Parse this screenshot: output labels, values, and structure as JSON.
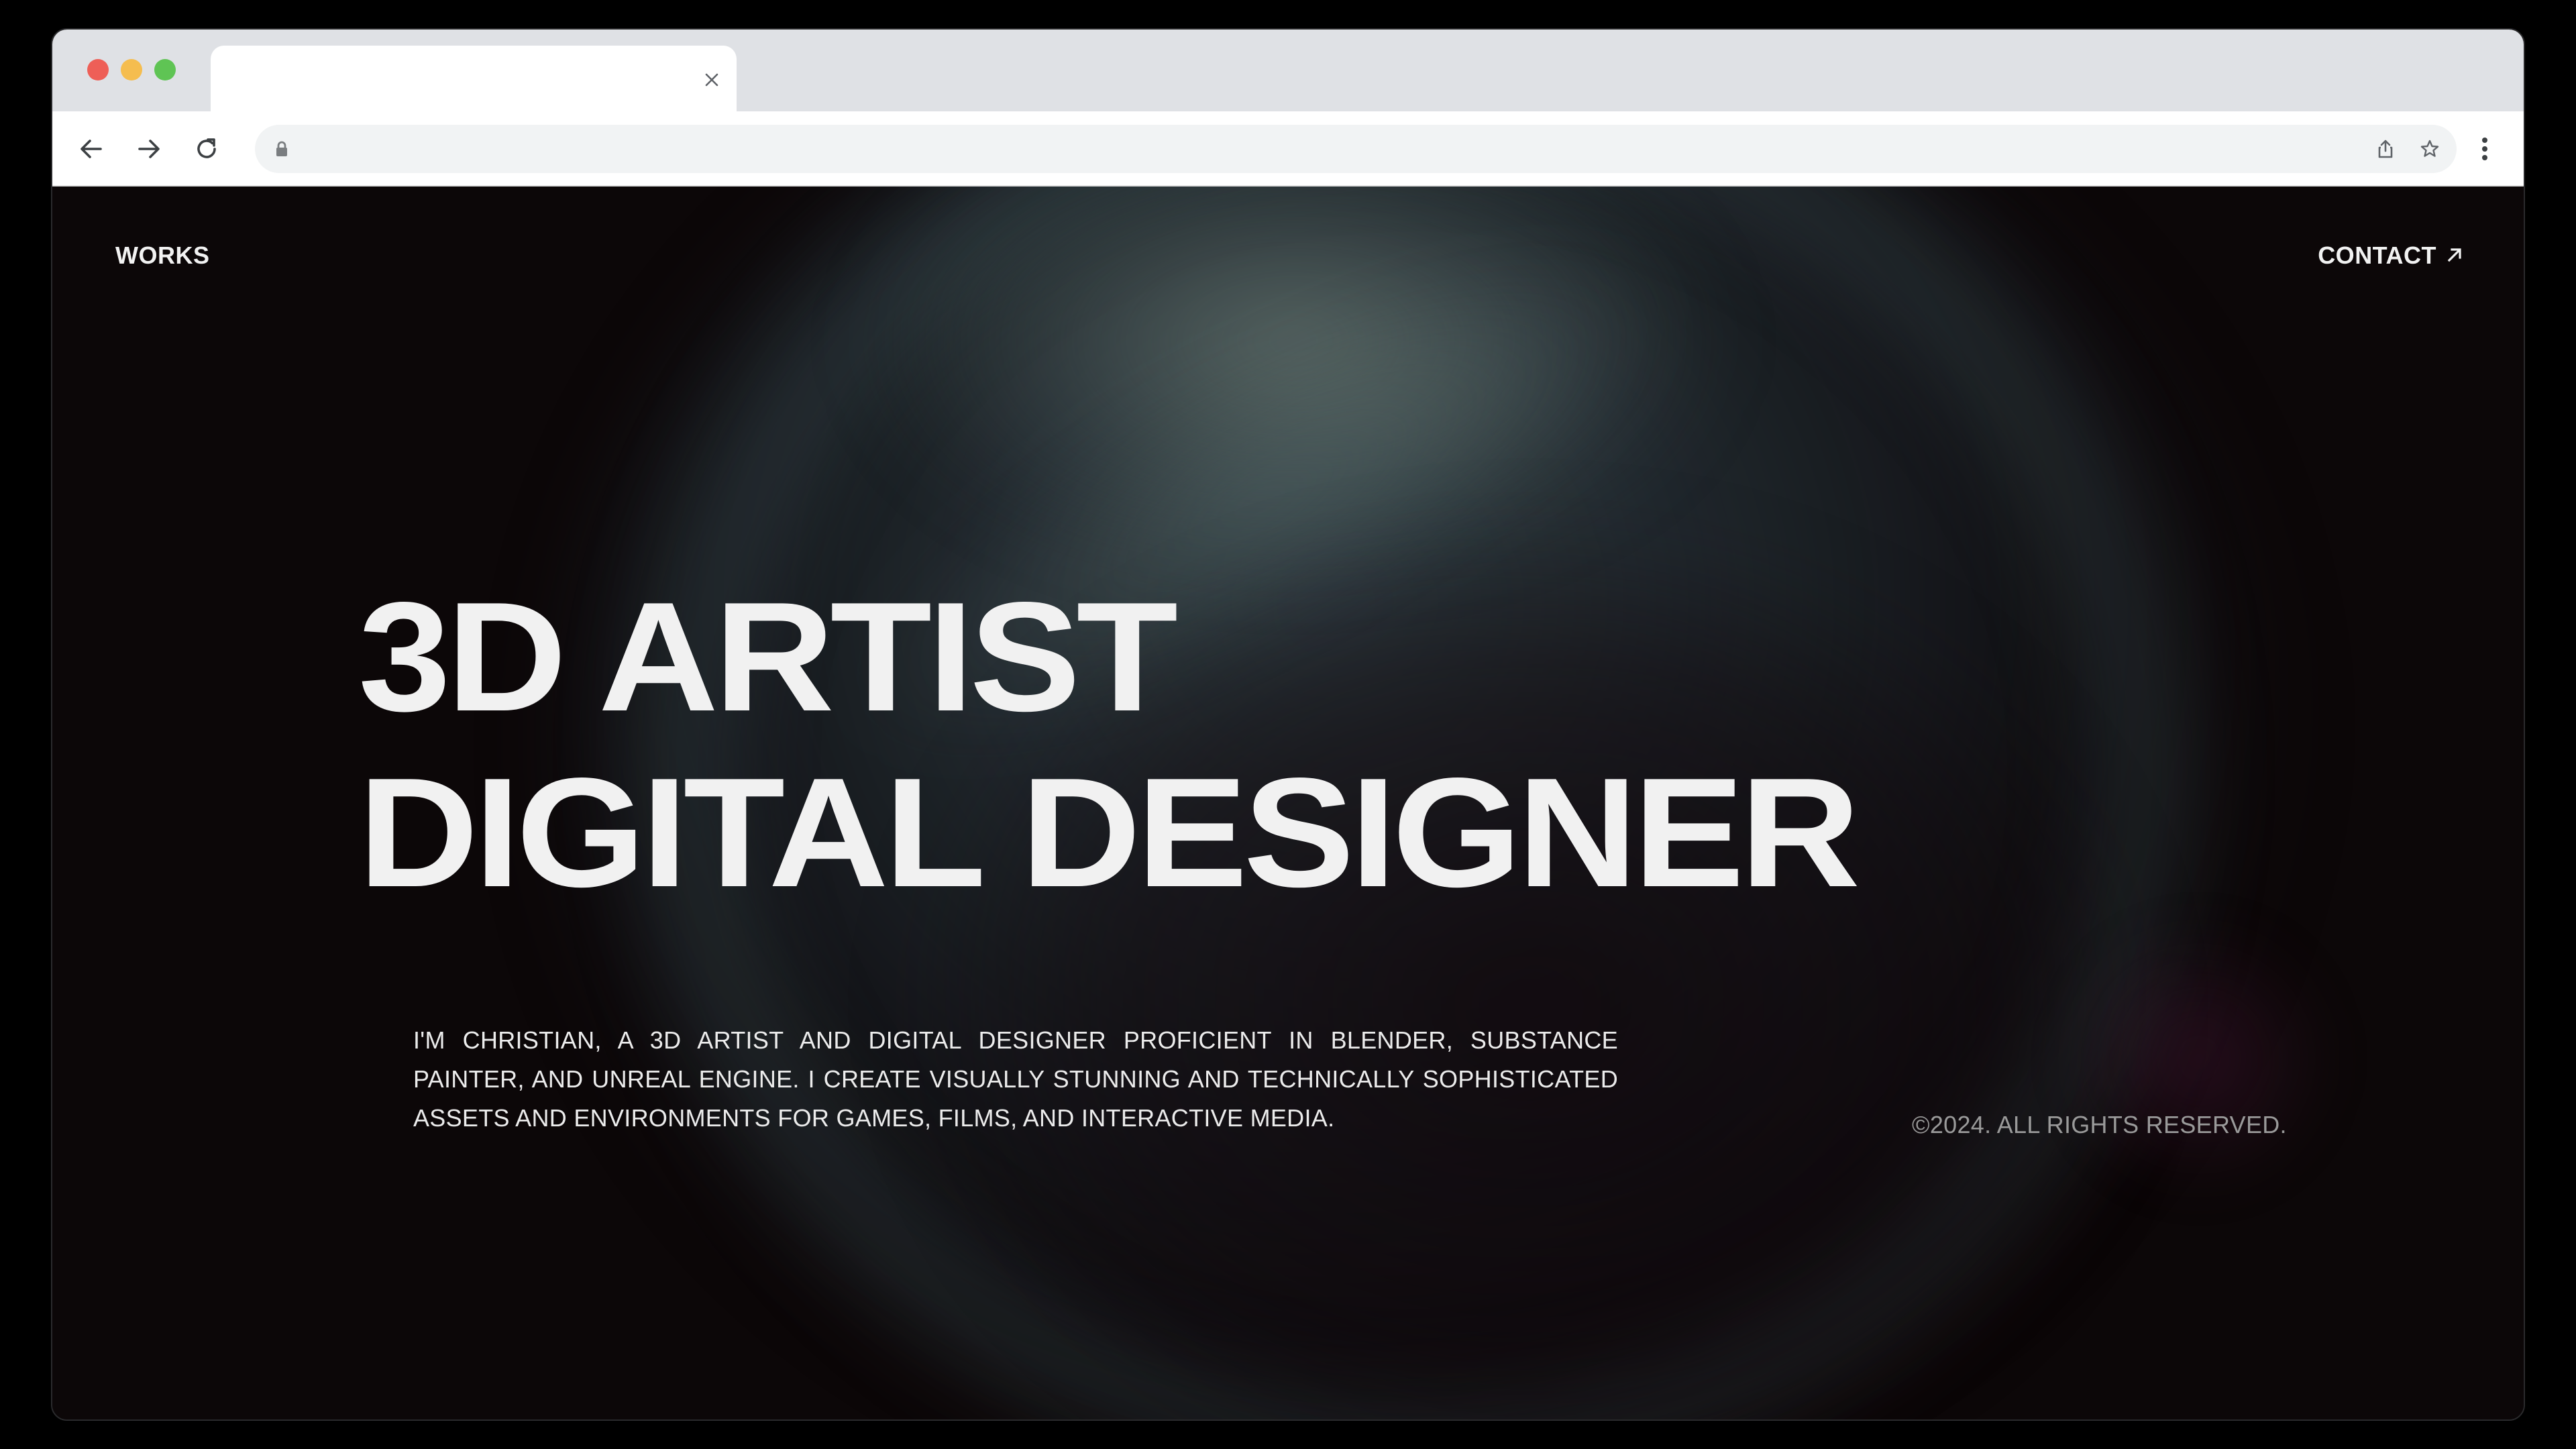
{
  "browser": {
    "tab": {
      "title": ""
    },
    "address_bar": {
      "url": ""
    },
    "icons": {
      "close": "close-icon",
      "back": "arrow-left-icon",
      "forward": "arrow-right-icon",
      "reload": "reload-icon",
      "lock": "lock-icon",
      "share": "share-icon",
      "bookmark": "star-icon",
      "menu": "kebab-menu-icon"
    },
    "traffic_light_colors": [
      "#ee5f57",
      "#f5bd4f",
      "#5fc454"
    ]
  },
  "page": {
    "nav": {
      "works_label": "WORKS",
      "contact_label": "CONTACT",
      "contact_icon": "arrow-up-right-icon"
    },
    "hero": {
      "line1": "3D ARTIST",
      "line2": "DIGITAL DESIGNER"
    },
    "bio": "I'M CHRISTIAN, A 3D ARTIST AND DIGITAL DESIGNER PROFICIENT IN BLENDER, SUBSTANCE PAINTER, AND UNREAL ENGINE. I CREATE VISUALLY STUNNING AND TECHNICALLY SOPHISTICATED ASSETS AND ENVIRONMENTS FOR GAMES, FILMS, AND INTERACTIVE MEDIA.",
    "copyright": "©2024. ALL RIGHTS RESERVED.",
    "colors": {
      "background": "#0c0708",
      "text": "#f1f1f1",
      "muted_text": "#9a9a9a"
    }
  }
}
